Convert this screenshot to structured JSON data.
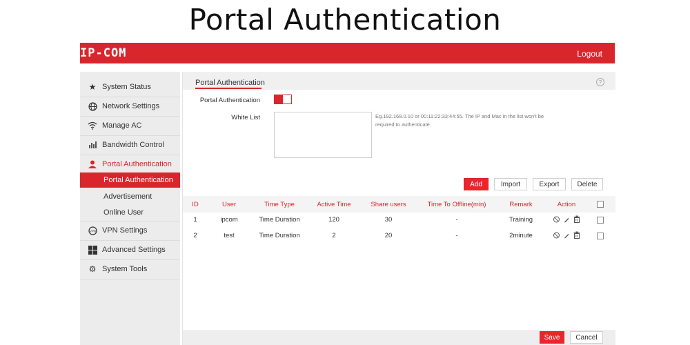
{
  "page_title": "Portal Authentication",
  "header": {
    "logo": "IP-COM",
    "logout": "Logout"
  },
  "sidebar": {
    "items": [
      {
        "label": "System Status",
        "icon": "star-icon"
      },
      {
        "label": "Network Settings",
        "icon": "globe-icon"
      },
      {
        "label": "Manage AC",
        "icon": "wifi-icon"
      },
      {
        "label": "Bandwidth Control",
        "icon": "bar-chart-icon"
      },
      {
        "label": "Portal Authentication",
        "icon": "user-icon"
      },
      {
        "label": "VPN Settings",
        "icon": "vpn-icon"
      },
      {
        "label": "Advanced Settings",
        "icon": "grid-icon"
      },
      {
        "label": "System Tools",
        "icon": "gears-icon"
      }
    ],
    "sub_items": [
      {
        "label": "Portal Authentication",
        "selected": true
      },
      {
        "label": "Advertisement",
        "selected": false
      },
      {
        "label": "Online User",
        "selected": false
      }
    ]
  },
  "main": {
    "section_title": "Portal Authentication",
    "portal_auth_label": "Portal Authentication",
    "portal_auth_enabled": true,
    "white_list_label": "White List",
    "white_list_value": "",
    "white_list_hint": "Eg.192.168.0.10 or 00:11:22:33:44:55. The IP and Mac in the list won't be required to authenticate.",
    "buttons": {
      "add": "Add",
      "import": "Import",
      "export": "Export",
      "delete": "Delete"
    },
    "table": {
      "columns": [
        "ID",
        "User",
        "Time Type",
        "Active Time",
        "Share users",
        "Time To Offline(min)",
        "Remark",
        "Action"
      ],
      "rows": [
        {
          "id": "1",
          "user": "ipcom",
          "time_type": "Time Duration",
          "active_time": "120",
          "share_users": "30",
          "offline": "-",
          "remark": "Training"
        },
        {
          "id": "2",
          "user": "test",
          "time_type": "Time Duration",
          "active_time": "2",
          "share_users": "20",
          "offline": "-",
          "remark": "2minute"
        }
      ]
    },
    "footer": {
      "save": "Save",
      "cancel": "Cancel"
    }
  },
  "colors": {
    "accent": "#d9262c"
  }
}
